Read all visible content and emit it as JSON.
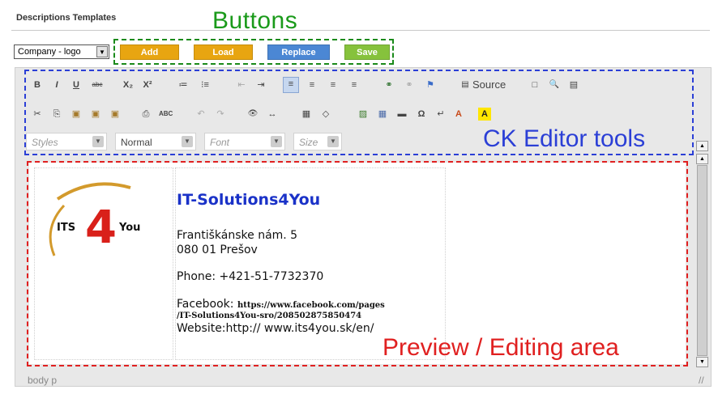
{
  "header": {
    "title": "Descriptions Templates"
  },
  "annotations": {
    "buttons": "Buttons",
    "tools": "CK Editor tools",
    "preview": "Preview / Editing area"
  },
  "template_select": {
    "value": "Company - logo"
  },
  "buttons": [
    {
      "label": "Add",
      "color": "#e8a511"
    },
    {
      "label": "Load",
      "color": "#e8a511"
    },
    {
      "label": "Replace",
      "color": "#4b87d4"
    },
    {
      "label": "Save",
      "color": "#86c23c"
    }
  ],
  "toolbar": {
    "row1": [
      "B",
      "I",
      "U",
      "abc",
      "X₂",
      "X²",
      "≔",
      "⁝≡",
      "⇤",
      "⇥",
      "≡",
      "≡",
      "≡",
      "≡",
      "⚭",
      "⚭",
      "⚑",
      "Source",
      "□",
      "🔍",
      "▤"
    ],
    "source_label": "Source",
    "row2": [
      "✂",
      "⎘",
      "▣",
      "▣",
      "▣",
      "⎙",
      "ABC",
      "↶",
      "↷",
      "👁",
      "↔",
      "▦",
      "◇",
      "▨",
      "▦",
      "▬",
      "Ω",
      "↵",
      "A",
      "A"
    ],
    "combos": [
      {
        "label": "Styles"
      },
      {
        "label": "Normal"
      },
      {
        "label": "Font"
      },
      {
        "label": "Size"
      }
    ]
  },
  "preview": {
    "logo_left": "ITS",
    "logo_num": "4",
    "logo_right": "You",
    "company": "IT-Solutions4You",
    "address1": "Františkánske nám. 5",
    "address2": "080 01 Prešov",
    "phone": "Phone: +421-51-7732370",
    "facebook_label": "Facebook:",
    "facebook_url1": "https://www.facebook.com/pages",
    "facebook_url2": "/IT-Solutions4You-sro/208502875850474",
    "website": "Website:http:// www.its4you.sk/en/"
  },
  "statusbar": {
    "path": "body  p"
  },
  "colors": {
    "accent_green": "#1a9a1a",
    "accent_blue": "#2b3fd6",
    "accent_red": "#e02020"
  }
}
